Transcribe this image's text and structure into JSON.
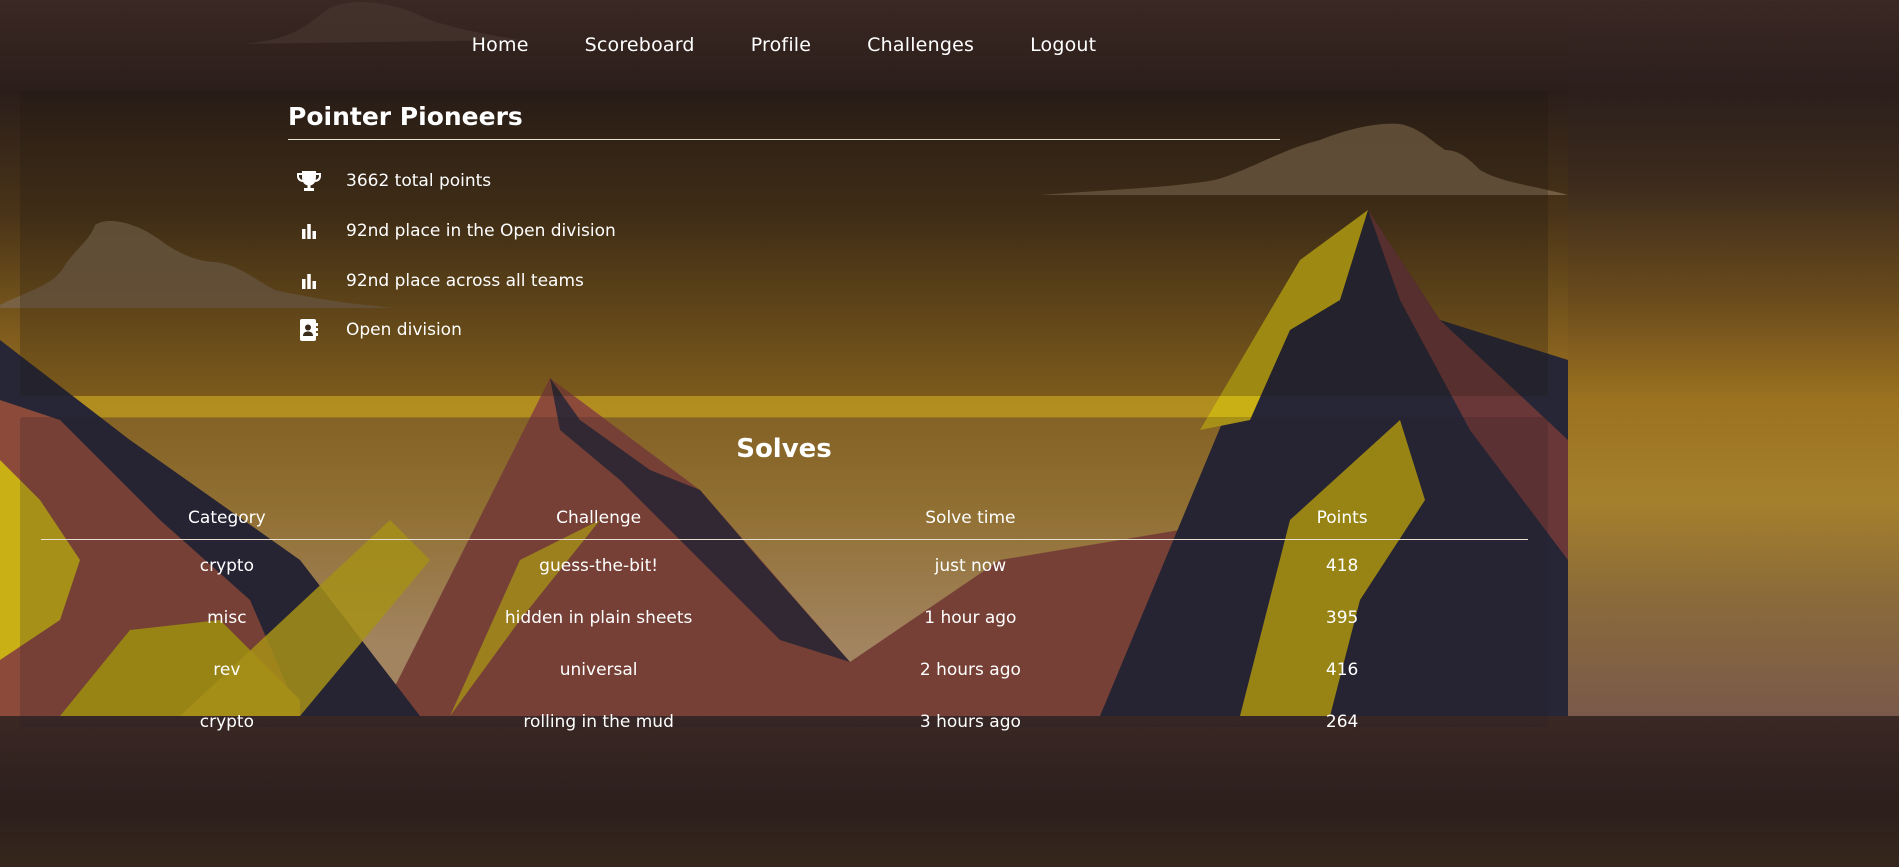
{
  "nav": {
    "items": [
      "Home",
      "Scoreboard",
      "Profile",
      "Challenges",
      "Logout"
    ]
  },
  "team": {
    "name": "Pointer Pioneers",
    "stats": [
      {
        "icon": "trophy-icon",
        "text": "3662 total points"
      },
      {
        "icon": "bar-chart-icon",
        "text": "92nd place in the Open division"
      },
      {
        "icon": "bar-chart-icon",
        "text": "92nd place across all teams"
      },
      {
        "icon": "contact-card-icon",
        "text": "Open division"
      }
    ]
  },
  "solves": {
    "title": "Solves",
    "columns": [
      "Category",
      "Challenge",
      "Solve time",
      "Points"
    ],
    "rows": [
      [
        "crypto",
        "guess-the-bit!",
        "just now",
        "418"
      ],
      [
        "misc",
        "hidden in plain sheets",
        "1 hour ago",
        "395"
      ],
      [
        "rev",
        "universal",
        "2 hours ago",
        "416"
      ],
      [
        "crypto",
        "rolling in the mud",
        "3 hours ago",
        "264"
      ]
    ]
  },
  "colors": {
    "text": "#ffffff",
    "mountain_yellow": "#c9b014",
    "mountain_dark": "#262636",
    "mountain_rust": "#8c4a3a"
  }
}
